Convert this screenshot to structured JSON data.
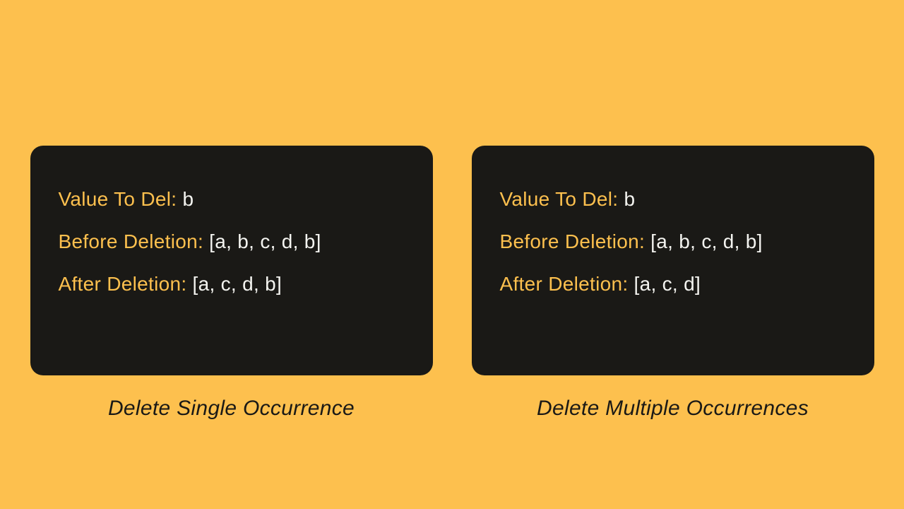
{
  "cards": [
    {
      "caption": "Delete Single Occurrence",
      "rows": [
        {
          "label": "Value To Del: ",
          "value": "b"
        },
        {
          "label": "Before Deletion: ",
          "value": "[a, b, c, d, b]"
        },
        {
          "label": "After Deletion: ",
          "value": "[a, c, d, b]"
        }
      ]
    },
    {
      "caption": "Delete Multiple Occurrences",
      "rows": [
        {
          "label": "Value To Del: ",
          "value": "b"
        },
        {
          "label": "Before Deletion: ",
          "value": "[a, b, c, d, b]"
        },
        {
          "label": "After Deletion: ",
          "value": "[a, c, d]"
        }
      ]
    }
  ]
}
